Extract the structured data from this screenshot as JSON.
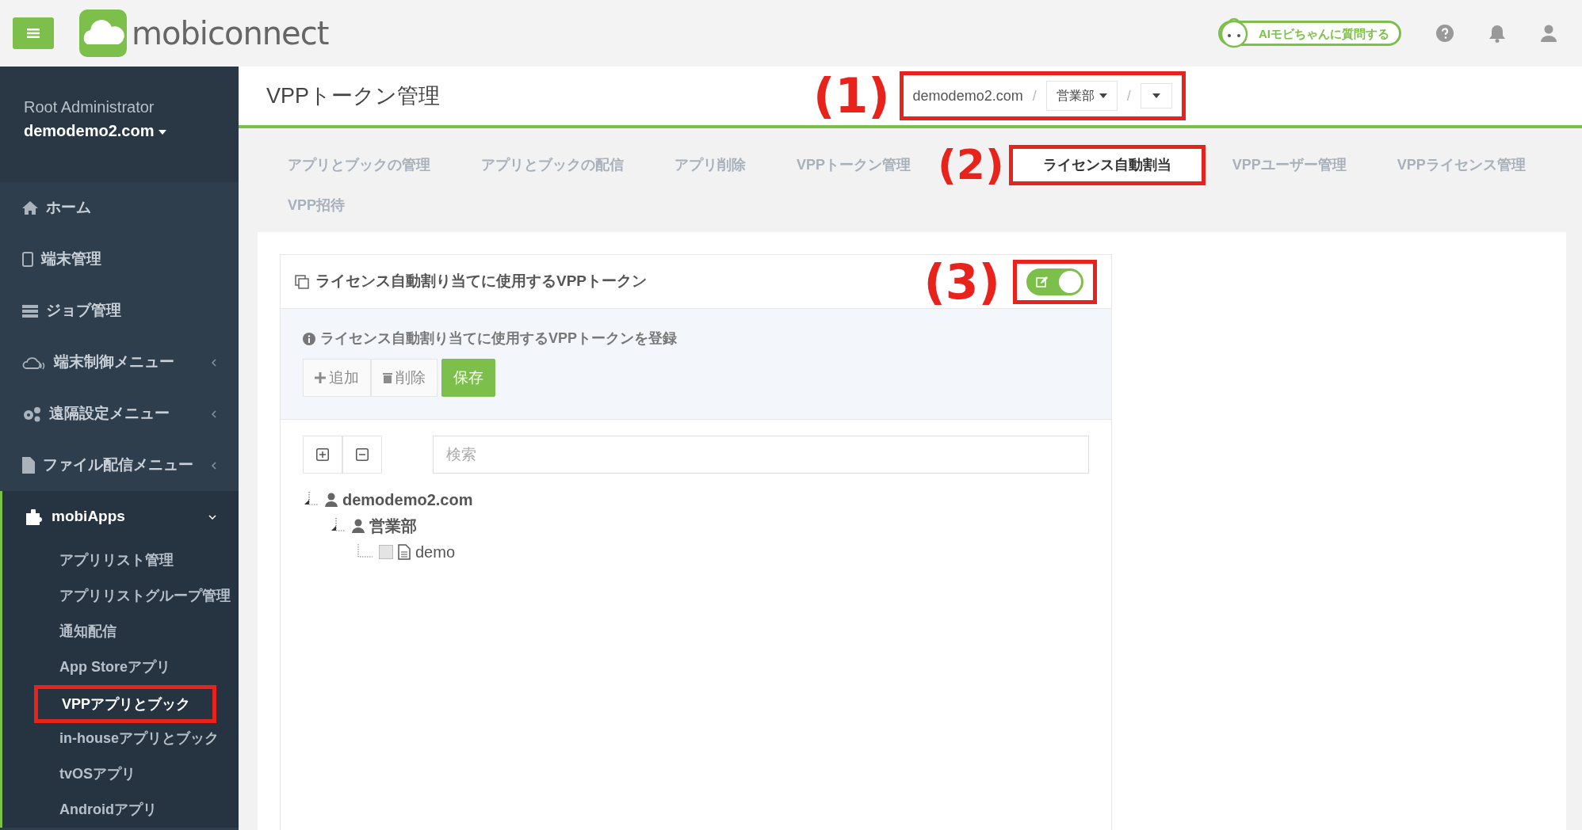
{
  "header": {
    "logo": "mobiconnect",
    "ai_button": "AIモビちゃんに質問する"
  },
  "sidebar": {
    "role": "Root Administrator",
    "account": "demodemo2.com",
    "items": [
      {
        "kind": "link",
        "label": "ホーム"
      },
      {
        "kind": "link",
        "label": "端末管理"
      },
      {
        "kind": "link",
        "label": "ジョブ管理"
      },
      {
        "kind": "menu",
        "label": "端末制御メニュー",
        "expanded": false
      },
      {
        "kind": "menu",
        "label": "遠隔設定メニュー",
        "expanded": false
      },
      {
        "kind": "menu",
        "label": "ファイル配信メニュー",
        "expanded": false
      },
      {
        "kind": "menu",
        "label": "mobiApps",
        "expanded": true,
        "children": [
          {
            "label": "アプリリスト管理",
            "selected": false,
            "highlighted": false
          },
          {
            "label": "アプリリストグループ管理",
            "selected": false,
            "highlighted": false
          },
          {
            "label": "通知配信",
            "selected": false,
            "highlighted": false
          },
          {
            "label": "App Storeアプリ",
            "selected": false,
            "highlighted": false
          },
          {
            "label": "VPPアプリとブック",
            "selected": true,
            "highlighted": true
          },
          {
            "label": "in-houseアプリとブック",
            "selected": false,
            "highlighted": false
          },
          {
            "label": "tvOSアプリ",
            "selected": false,
            "highlighted": false
          },
          {
            "label": "Androidアプリ",
            "selected": false,
            "highlighted": false
          }
        ]
      }
    ]
  },
  "page": {
    "title": "VPPトークン管理",
    "breadcrumb": {
      "annotation_label": "(1)",
      "items": [
        {
          "kind": "text",
          "label": "demodemo2.com"
        },
        {
          "kind": "separator",
          "label": "/"
        },
        {
          "kind": "dropdown",
          "label": "営業部"
        },
        {
          "kind": "separator",
          "label": "/"
        },
        {
          "kind": "caret"
        }
      ]
    }
  },
  "tabs": [
    {
      "label": "アプリとブックの管理",
      "selected": false
    },
    {
      "label": "アプリとブックの配信",
      "selected": false
    },
    {
      "label": "アプリ削除",
      "selected": false
    },
    {
      "label": "VPPトークン管理",
      "selected": false
    },
    {
      "label": "ライセンス自動割当",
      "selected": true,
      "annotation_label": "(2)"
    },
    {
      "label": "VPPユーザー管理",
      "selected": false
    },
    {
      "label": "VPPライセンス管理",
      "selected": false
    },
    {
      "label": "VPP招待",
      "selected": false
    }
  ],
  "card": {
    "title": "ライセンス自動割り当てに使用するVPPトークン",
    "toggle": {
      "on": true,
      "annotation_label": "(3)"
    },
    "info": "ライセンス自動割り当てに使用するVPPトークンを登録",
    "buttons": [
      {
        "kind": "add",
        "label": "追加",
        "disabled": true
      },
      {
        "kind": "delete",
        "label": "削除",
        "disabled": true
      },
      {
        "kind": "save",
        "label": "保存",
        "disabled": false
      }
    ],
    "search": {
      "placeholder": "検索"
    },
    "tree": [
      {
        "kind": "user",
        "label": "demodemo2.com",
        "expanded": true,
        "children": [
          {
            "kind": "user",
            "label": "営業部",
            "expanded": true,
            "children": [
              {
                "kind": "file",
                "label": "demo",
                "checked": false
              }
            ]
          }
        ]
      }
    ]
  }
}
